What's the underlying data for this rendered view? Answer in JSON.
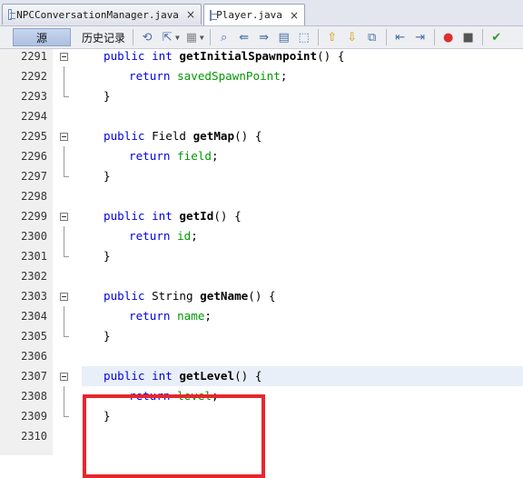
{
  "tabs": [
    {
      "label": "NPCConversationManager.java",
      "close": "×",
      "active": false
    },
    {
      "label": "Player.java",
      "close": "×",
      "active": true
    }
  ],
  "toolbar": {
    "source_label": "源",
    "history_label": "历史记录",
    "icons": [
      "back-icon",
      "forward-icon",
      "find-icon",
      "find-previous-icon",
      "find-next-icon",
      "toggle-highlight-icon",
      "find-selection-icon",
      "previous-bookmark-icon",
      "next-bookmark-icon",
      "toggle-bookmark-icon",
      "shift-left-icon",
      "shift-right-icon",
      "record-macro-icon",
      "stop-macro-icon",
      "run-icon"
    ]
  },
  "editor": {
    "current_line": 2307,
    "highlight_color": "#e8262d",
    "lines": [
      {
        "num": "2291",
        "kind": "sig",
        "ret": "int",
        "name": "getInitialSpawnpoint"
      },
      {
        "num": "2292",
        "kind": "ret",
        "value": "savedSpawnPoint"
      },
      {
        "num": "2293",
        "kind": "close"
      },
      {
        "num": "2294",
        "kind": "blank"
      },
      {
        "num": "2295",
        "kind": "sig",
        "ret": "Field",
        "name": "getMap"
      },
      {
        "num": "2296",
        "kind": "ret",
        "value": "field"
      },
      {
        "num": "2297",
        "kind": "close"
      },
      {
        "num": "2298",
        "kind": "blank"
      },
      {
        "num": "2299",
        "kind": "sig",
        "ret": "int",
        "name": "getId"
      },
      {
        "num": "2300",
        "kind": "ret",
        "value": "id"
      },
      {
        "num": "2301",
        "kind": "close"
      },
      {
        "num": "2302",
        "kind": "blank"
      },
      {
        "num": "2303",
        "kind": "sig",
        "ret": "String",
        "name": "getName"
      },
      {
        "num": "2304",
        "kind": "ret",
        "value": "name"
      },
      {
        "num": "2305",
        "kind": "close"
      },
      {
        "num": "2306",
        "kind": "blank"
      },
      {
        "num": "2307",
        "kind": "sig",
        "ret": "int",
        "name": "getLevel"
      },
      {
        "num": "2308",
        "kind": "ret",
        "value": "level"
      },
      {
        "num": "2309",
        "kind": "close"
      },
      {
        "num": "2310",
        "kind": "blank"
      }
    ],
    "tokens": {
      "public": "public",
      "return": "return",
      "int": "int",
      "open": "() {",
      "semi": ";",
      "brace": "}"
    }
  }
}
